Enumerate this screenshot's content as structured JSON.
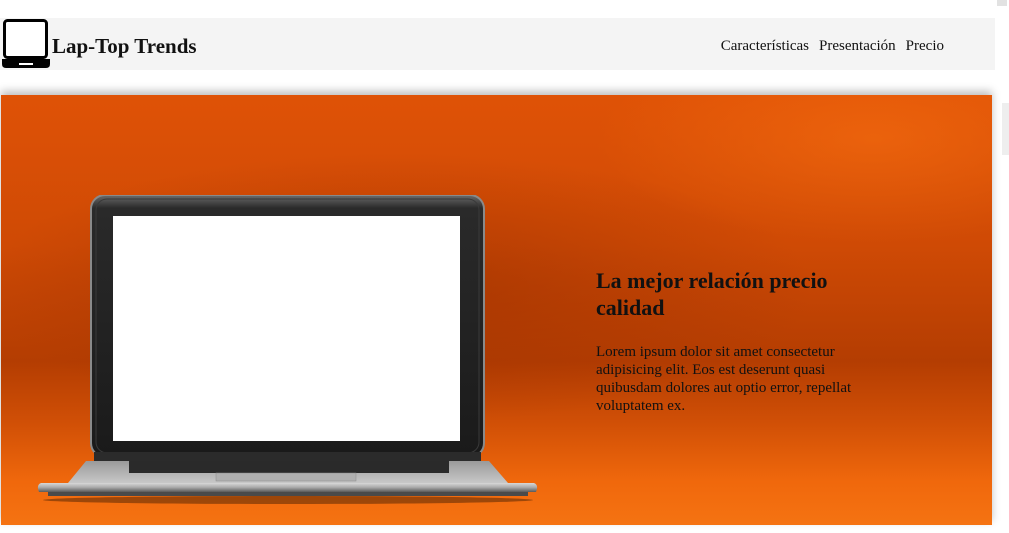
{
  "header": {
    "brand": "Lap-Top Trends",
    "logo_icon": "laptop-icon",
    "nav": [
      {
        "label": "Características"
      },
      {
        "label": "Presentación"
      },
      {
        "label": "Precio"
      }
    ]
  },
  "hero": {
    "image_icon": "laptop-image",
    "title": "La mejor relación precio calidad",
    "body": "Lorem ipsum dolor sit amet consectetur adipisicing elit. Eos est deserunt quasi quibusdam dolores aut optio error, repellat voluptatem ex."
  },
  "colors": {
    "header_bg": "#f4f4f4",
    "hero_orange": "#df5206",
    "text": "#111111"
  }
}
